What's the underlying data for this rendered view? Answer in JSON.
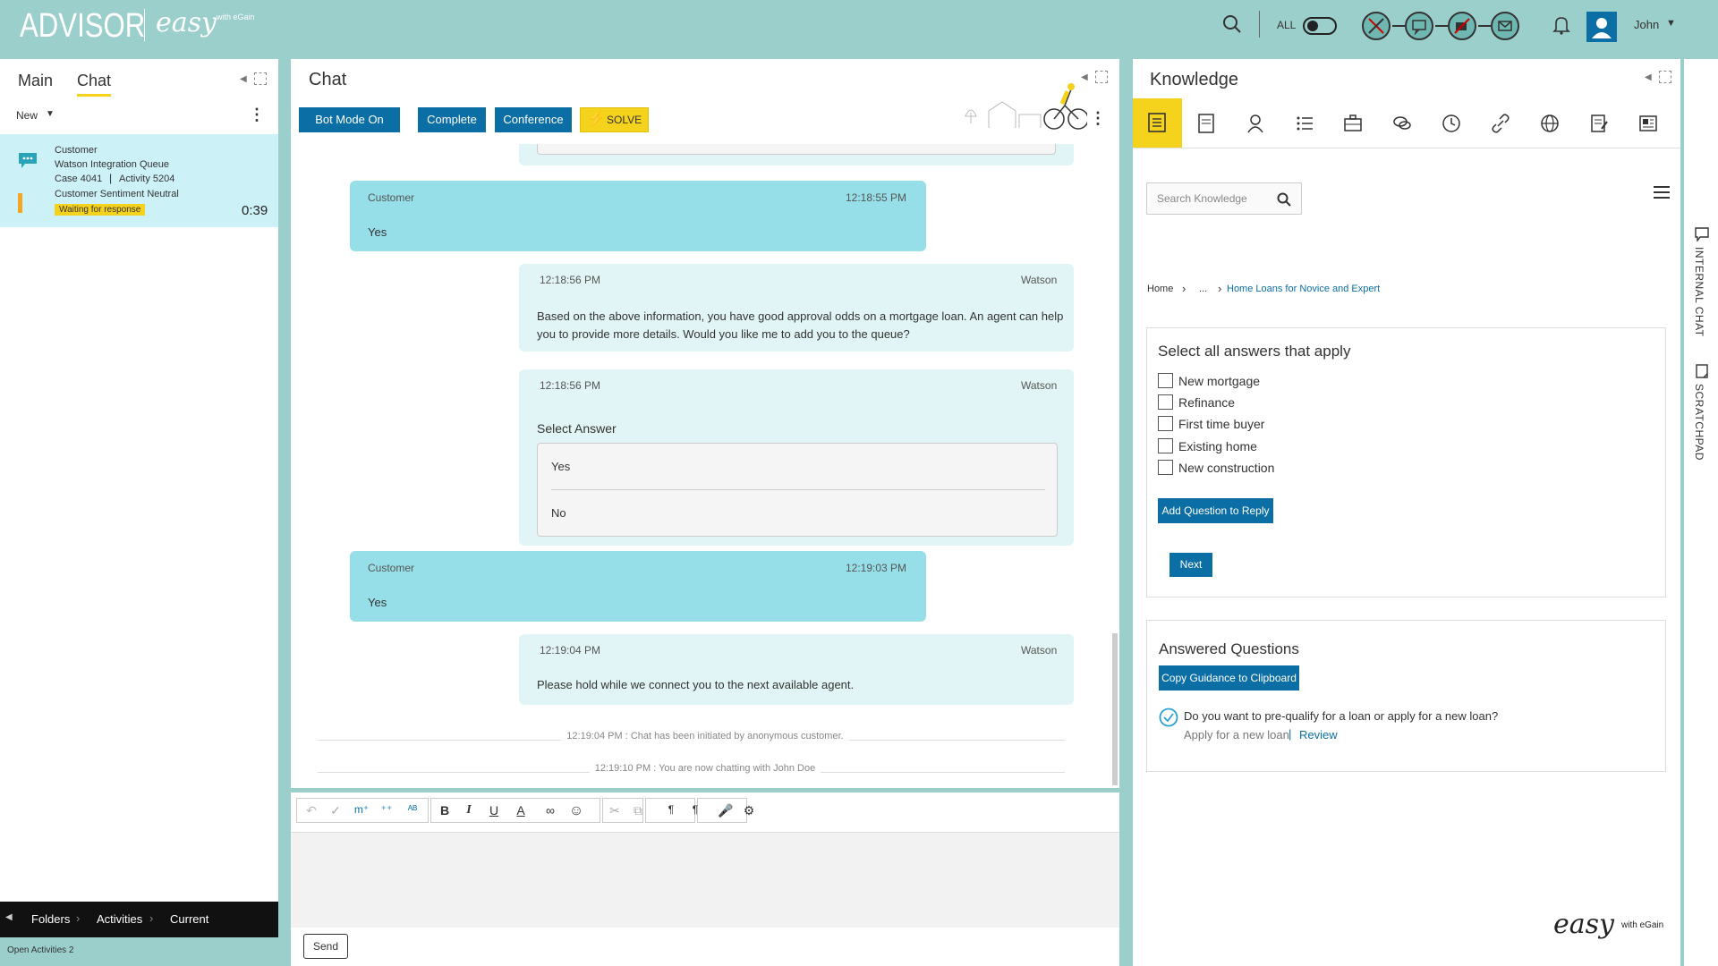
{
  "app": {
    "title": "ADVISOR",
    "brand_easy": "easy",
    "brand_with": "with eGain"
  },
  "topbar": {
    "all_label": "ALL",
    "user_name": "John"
  },
  "left": {
    "tabs": [
      "Main",
      "Chat"
    ],
    "filter_label": "New",
    "activity": {
      "customer": "Customer",
      "queue": "Watson Integration Queue",
      "case": "Case 4041",
      "activity": "Activity 5204",
      "sentiment": "Customer Sentiment Neutral",
      "status": "Waiting for response",
      "timer": "0:39"
    },
    "footer": {
      "folders": "Folders",
      "activities": "Activities",
      "current": "Current",
      "open_activities": "Open Activities 2"
    }
  },
  "chat": {
    "title": "Chat",
    "buttons": {
      "bot_mode": "Bot Mode On",
      "complete": "Complete",
      "conference": "Conference",
      "solve": "SOLVE"
    },
    "messages": [
      {
        "sender": "Customer",
        "time": "12:18:55 PM",
        "text": "Yes"
      },
      {
        "sender": "Watson",
        "time": "12:18:56 PM",
        "text": "Based on the above information, you have good approval odds on a mortgage loan. An agent can help you to provide more details. Would you like me to add you to the queue?"
      },
      {
        "sender": "Watson",
        "time": "12:18:56 PM",
        "text": "Select Answer",
        "options": [
          "Yes",
          "No"
        ]
      },
      {
        "sender": "Customer",
        "time": "12:19:03 PM",
        "text": "Yes"
      },
      {
        "sender": "Watson",
        "time": "12:19:04 PM",
        "text": "Please hold while we connect you to the next available agent."
      }
    ],
    "system": [
      "12:19:04 PM : Chat has been initiated by anonymous customer.",
      "12:19:10 PM : You are now chatting with John Doe"
    ],
    "send_label": "Send"
  },
  "knowledge": {
    "title": "Knowledge",
    "search_placeholder": "Search Knowledge",
    "breadcrumb": {
      "home": "Home",
      "ellipsis": "...",
      "current": "Home Loans for Novice and Expert"
    },
    "question_title": "Select all answers that apply",
    "options": [
      "New mortgage",
      "Refinance",
      "First time buyer",
      "Existing home",
      "New construction"
    ],
    "add_question_label": "Add Question to Reply",
    "next_label": "Next",
    "answered": {
      "title": "Answered Questions",
      "copy_label": "Copy Guidance to Clipboard",
      "question": "Do you want to pre-qualify for a loan or apply for a new loan?",
      "answer": "Apply for a new loan",
      "review": "Review"
    },
    "brand_easy": "easy",
    "brand_with": "with eGain"
  },
  "sidebar": {
    "internal_chat": "INTERNAL CHAT",
    "scratchpad": "SCRATCHPAD"
  },
  "colors": {
    "accent_teal": "#9bcfcc",
    "primary_blue": "#0b6ea5",
    "solve_yellow": "#f5d21b",
    "customer_bubble": "#97dfe8",
    "bot_bubble": "#e1f5f6"
  }
}
